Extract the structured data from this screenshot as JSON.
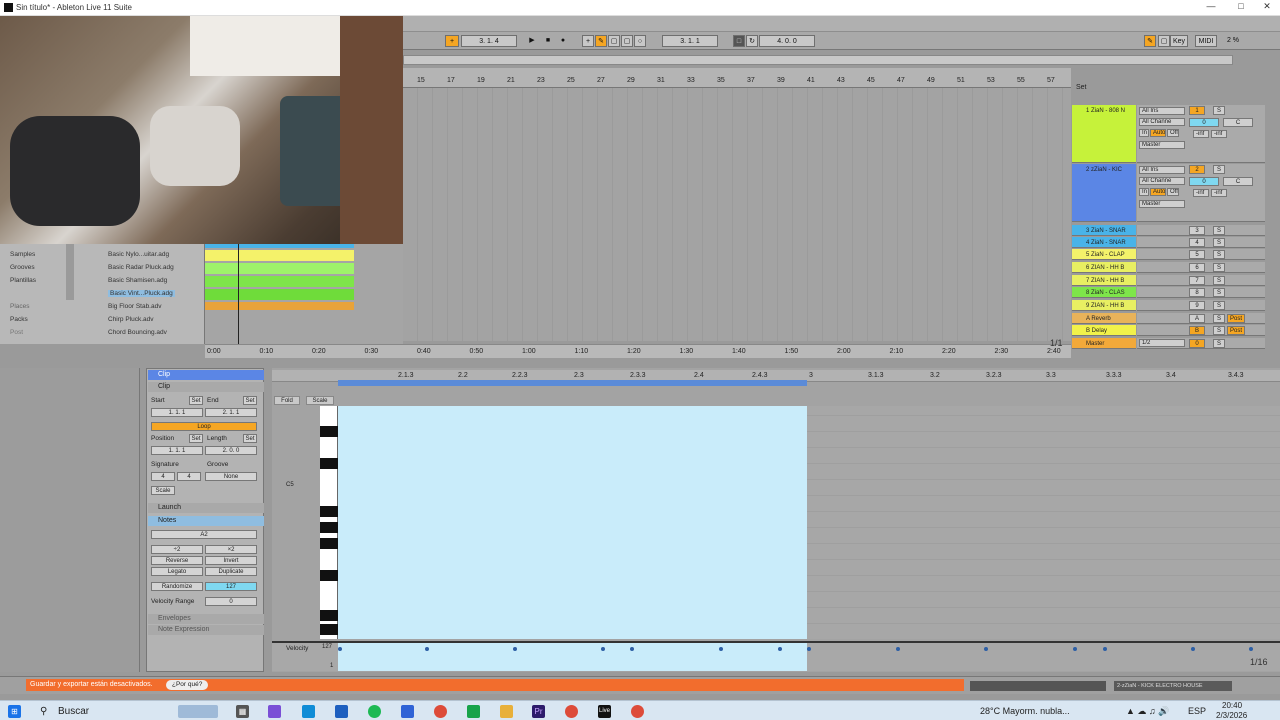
{
  "window": {
    "title": "Sin título* - Ableton Live 11 Suite"
  },
  "transport": {
    "tempo_pos": "3.  1.  4",
    "arr_pos": "3.  1.  1",
    "loop_len": "4.  0.  0",
    "key_label": "Key",
    "midi_label": "MIDI",
    "cpu": "2 %"
  },
  "arrangement": {
    "ruler": [
      "15",
      "17",
      "19",
      "21",
      "23",
      "25",
      "27",
      "29",
      "31",
      "33",
      "35",
      "37",
      "39",
      "41",
      "43",
      "45",
      "47",
      "49",
      "51",
      "53",
      "55",
      "57"
    ],
    "set_label": "Set",
    "page": "1/1"
  },
  "tracks": [
    {
      "name": "1 ZiaN - 808 N",
      "color": "#c6f23a",
      "num": "1",
      "in": "All Ins",
      "ch": "All Channe",
      "out": "Master",
      "vol": "0",
      "pan": "C"
    },
    {
      "name": "2 zZiaN - KIC",
      "color": "#5b86e5",
      "num": "2",
      "in": "All Ins",
      "ch": "All Channe",
      "out": "Master",
      "vol": "0",
      "pan": "C"
    },
    {
      "name": "3 ZiaN - SNAR",
      "color": "#49b3e8",
      "num": "3"
    },
    {
      "name": "4 ZiaN - SNAR",
      "color": "#49b3e8",
      "num": "4"
    },
    {
      "name": "5 ZiaN - CLAP",
      "color": "#f4f26a",
      "num": "5"
    },
    {
      "name": "6 ZIAN - HH B",
      "color": "#e8ef62",
      "num": "6"
    },
    {
      "name": "7 ZIAN - HH B",
      "color": "#e8ef62",
      "num": "7"
    },
    {
      "name": "8 ZiaN - CLAS",
      "color": "#7ee54a",
      "num": "8"
    },
    {
      "name": "9 ZIAN - HH B",
      "color": "#e8ef62",
      "num": "9"
    },
    {
      "name": "A Reverb",
      "color": "#e8b35a",
      "num": "A"
    },
    {
      "name": "B Delay",
      "color": "#f2f24a",
      "num": "B"
    },
    {
      "name": "Master",
      "color": "#f2a93a",
      "num": "0",
      "out": "1/2"
    }
  ],
  "io_labels": {
    "in": "In",
    "auto": "Auto",
    "off": "Off",
    "inf": "-inf",
    "s": "S",
    "post": "Post"
  },
  "browser": {
    "places_label": "Places",
    "categories": [
      "Samples",
      "Grooves",
      "Plantillas",
      "Packs",
      "Post"
    ],
    "files": [
      "Basic Nylo...uitar.adg",
      "Basic Radar Pluck.adg",
      "Basic Shamisen.adg",
      "Basic Vint...Pluck.adg",
      "Big Floor Stab.adv",
      "Chirp Pluck.adv",
      "Chord Bouncing.adv"
    ]
  },
  "timebar": [
    "0:00",
    "0:10",
    "0:20",
    "0:30",
    "0:40",
    "0:50",
    "1:00",
    "1:10",
    "1:20",
    "1:30",
    "1:40",
    "1:50",
    "2:00",
    "2:10",
    "2:20",
    "2:30",
    "2:40"
  ],
  "clip": {
    "header": "Clip",
    "sub": "Clip",
    "start_label": "Start",
    "end_label": "End",
    "set": "Set",
    "start": "1.  1.  1",
    "end": "2.  1.  1",
    "loop": "Loop",
    "position_label": "Position",
    "length_label": "Length",
    "position": "1.  1.  1",
    "length": "2.  0.  0",
    "signature_label": "Signature",
    "groove_label": "Groove",
    "sig_num": "4",
    "sig_den": "4",
    "groove": "None",
    "scale": "Scale",
    "launch": "Launch",
    "notes": "Notes",
    "note_name": "A2",
    "x2a": "÷2",
    "x2b": "×2",
    "reverse": "Reverse",
    "invert": "Invert",
    "legato": "Legato",
    "duplicate": "Duplicate",
    "randomize": "Randomize",
    "rand_val": "127",
    "vel_range_label": "Velocity Range",
    "vel_range": "0",
    "envelopes": "Envelopes",
    "note_expression": "Note Expression"
  },
  "midi": {
    "ruler": [
      "2.1.3",
      "2.2",
      "2.2.3",
      "2.3",
      "2.3.3",
      "2.4",
      "2.4.3",
      "3",
      "3.1.3",
      "3.2",
      "3.2.3",
      "3.3",
      "3.3.3",
      "3.4",
      "3.4.3"
    ],
    "fold": "Fold",
    "scale": "Scale",
    "c5": "C5",
    "velocity_label": "Velocity",
    "vel_max": "127",
    "vel_min": "1",
    "page": "1/16"
  },
  "status": {
    "warning": "Guardar y exportar están desactivados.",
    "why": "¿Por qué?",
    "track_info": "2-zZiaN - KICK ELECTRO HOUSE"
  },
  "taskbar": {
    "search": "Buscar",
    "weather": "28°C  Mayorm. nubla...",
    "lang": "ESP",
    "time": "20:40",
    "date": "2/3/2026"
  }
}
